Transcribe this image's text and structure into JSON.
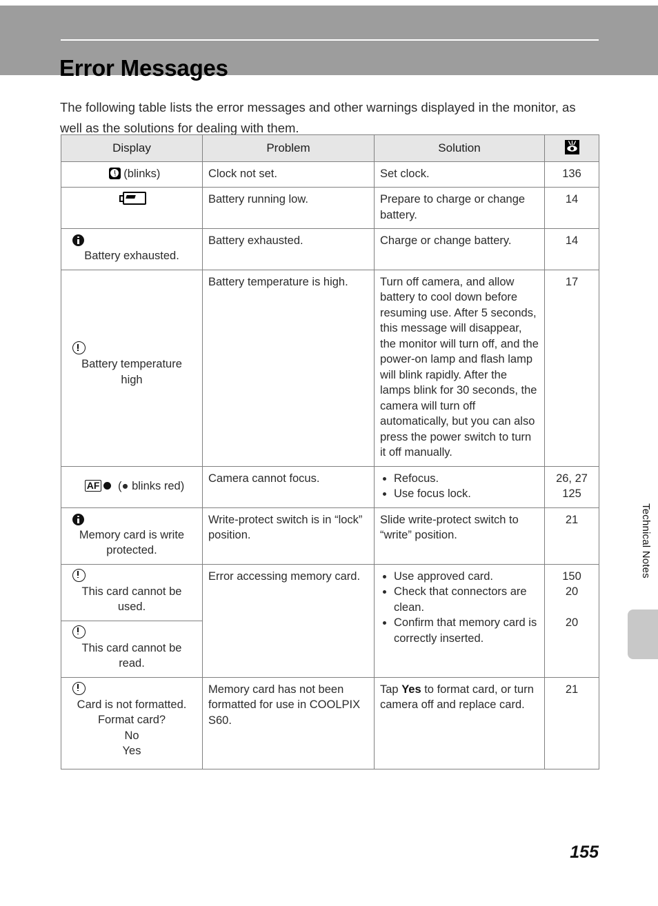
{
  "page": {
    "title": "Error Messages",
    "intro": "The following table lists the error messages and other warnings displayed in the monitor, as well as the solutions for dealing with them.",
    "side_tab_label": "Technical Notes",
    "folio": "155",
    "accent_header_color": "#9d9d9d",
    "table_header_fill": "#e6e6e6",
    "rule_color": "#808080",
    "thumb_tab_color": "#c8c8c8"
  },
  "table": {
    "headers": {
      "display": "Display",
      "problem": "Problem",
      "solution": "Solution",
      "reference_icon": "reference-eye-icon"
    },
    "rows": [
      {
        "display": {
          "icon": "clock-icon",
          "inline_text": "(blinks)",
          "message_lines": []
        },
        "problem": "Clock not set.",
        "solution": "Set clock.",
        "solution_bullets": [],
        "page_refs": "136"
      },
      {
        "display": {
          "icon": "battery-low-icon",
          "inline_text": "",
          "message_lines": []
        },
        "problem": "Battery running low.",
        "solution": "Prepare to charge or change battery.",
        "solution_bullets": [],
        "page_refs": "14"
      },
      {
        "display": {
          "icon": "info-icon",
          "inline_text": "",
          "message_lines": [
            "Battery exhausted."
          ]
        },
        "problem": "Battery exhausted.",
        "solution": "Charge or change battery.",
        "solution_bullets": [],
        "page_refs": "14"
      },
      {
        "display": {
          "icon": "warning-icon",
          "inline_text": "",
          "message_lines": [
            "Battery temperature",
            "high"
          ]
        },
        "problem": "Battery temperature is high.",
        "solution": "Turn off camera, and allow battery to cool down before resuming use. After 5 seconds, this message will disappear, the monitor will turn off, and the power-on lamp and flash lamp will blink rapidly. After the lamps blink for 30 seconds, the camera will turn off automatically, but you can also press the power switch to turn it off manually.",
        "solution_bullets": [],
        "page_refs": "17"
      },
      {
        "display": {
          "icon": "af-focus-icon",
          "inline_text": "(● blinks red)",
          "message_lines": []
        },
        "problem": "Camera cannot focus.",
        "solution": "",
        "solution_bullets": [
          "Refocus.",
          "Use focus lock."
        ],
        "page_refs": "26, 27\n125"
      },
      {
        "display": {
          "icon": "info-icon",
          "inline_text": "",
          "message_lines": [
            "Memory card is write",
            "protected."
          ]
        },
        "problem": "Write-protect switch is in “lock” position.",
        "solution": "Slide write-protect switch to “write” position.",
        "solution_bullets": [],
        "page_refs": "21"
      },
      {
        "display": {
          "icon": "warning-icon",
          "inline_text": "",
          "message_lines": [
            "This card cannot be",
            "used."
          ]
        },
        "problem": "Error accessing memory card.",
        "solution": "",
        "solution_bullets": [
          "Use approved card.",
          "Check that connectors are clean.",
          "Confirm that memory card is correctly inserted."
        ],
        "page_refs": "150\n20\n\n20"
      },
      {
        "display": {
          "icon": "warning-icon",
          "inline_text": "",
          "message_lines": [
            "This card cannot be",
            "read."
          ]
        },
        "problem": "",
        "solution": "",
        "solution_bullets": [],
        "page_refs": ""
      },
      {
        "display": {
          "icon": "warning-icon",
          "inline_text": "",
          "message_lines": [
            "Card is not formatted.",
            "Format card?",
            "No",
            "Yes"
          ]
        },
        "problem": "Memory card has not been formatted for use in COOLPIX S60.",
        "solution_prefix": "Tap ",
        "solution_bold": "Yes",
        "solution_suffix": " to format card, or turn camera off and replace card.",
        "solution": "",
        "solution_bullets": [],
        "page_refs": "21"
      }
    ]
  }
}
